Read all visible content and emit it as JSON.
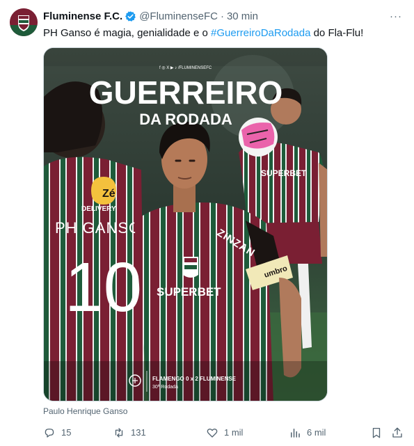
{
  "tweet": {
    "author_name": "Fluminense F.C.",
    "author_handle": "@FluminenseFC",
    "separator": "·",
    "time": "30 min",
    "more_label": "···",
    "text_before": "PH Ganso é magia, genialidade e o ",
    "hashtag": "#GuerreiroDaRodada",
    "text_after": " do Fla-Flu!",
    "media_alt": "Paulo Henrique Ganso",
    "caption": "Paulo Henrique Ganso"
  },
  "media": {
    "socials": "f ◎ X ▶ ♪ /FLUMINENSEFC",
    "headline_1": "GUERREIRO",
    "headline_2": "DA RODADA",
    "back_name": "PH GANSO",
    "back_number": "10",
    "sponsor_ze_1": "Zé",
    "sponsor_ze_2": "DELIVERY",
    "shirt_sponsor": "SUPERBET",
    "sleeve_sponsor": "ZINZAN",
    "armband_brand": "umbro",
    "score_line": "FLAMENGO 0 x 2 FLUMINENSE",
    "round": "30ª Rodada"
  },
  "actions": {
    "replies": "15",
    "reposts": "131",
    "likes": "1 mil",
    "views": "6 mil"
  },
  "colors": {
    "accent": "#1d9bf0",
    "text": "#0f1419",
    "muted": "#536471",
    "grena": "#7a1f33",
    "green": "#1e5b3a"
  }
}
